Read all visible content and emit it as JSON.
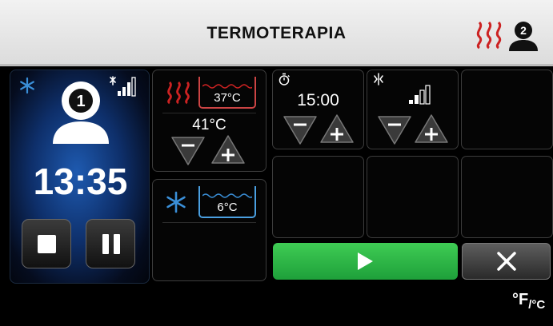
{
  "header": {
    "title": "TERMOTERAPIA",
    "user_number": "2"
  },
  "patient": {
    "number": "1",
    "time_remaining": "13:35"
  },
  "heat": {
    "water_temp": "37°C",
    "setpoint": "41°C"
  },
  "cold": {
    "water_temp": "6°C"
  },
  "timer": {
    "value": "15:00"
  },
  "intensity": {
    "level": 2,
    "max": 4
  },
  "units": {
    "main": "°F",
    "sub": "/°C"
  },
  "colors": {
    "heat": "#cc2222",
    "cold": "#3a8fd8",
    "start": "#2bb548",
    "header_bg": "#e6e6e6"
  }
}
